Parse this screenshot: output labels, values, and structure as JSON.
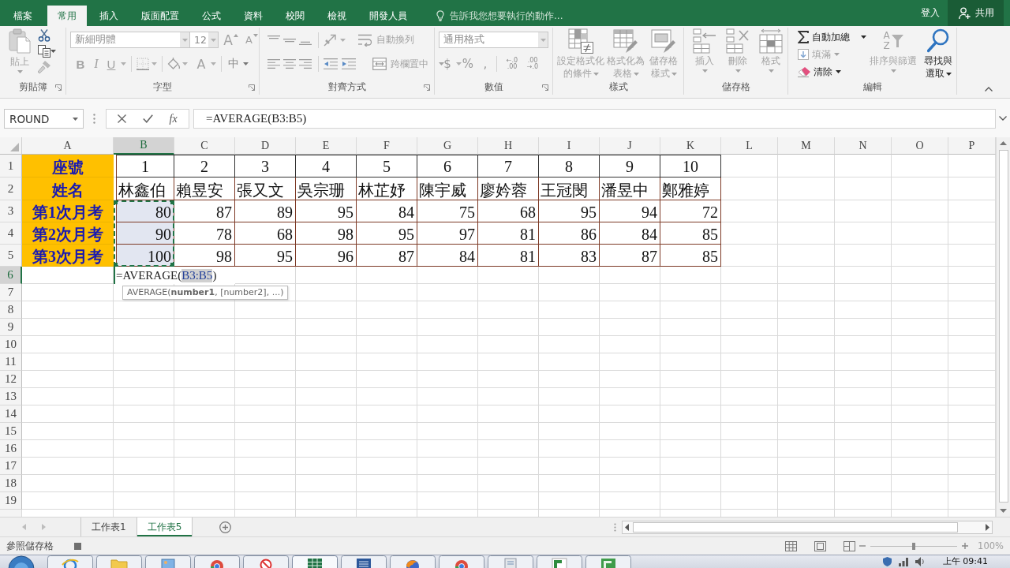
{
  "ribbon_tabs": [
    {
      "label": "檔案",
      "selected": false
    },
    {
      "label": "常用",
      "selected": true
    },
    {
      "label": "插入",
      "selected": false
    },
    {
      "label": "版面配置",
      "selected": false
    },
    {
      "label": "公式",
      "selected": false
    },
    {
      "label": "資料",
      "selected": false
    },
    {
      "label": "校閱",
      "selected": false
    },
    {
      "label": "檢視",
      "selected": false
    },
    {
      "label": "開發人員",
      "selected": false
    }
  ],
  "tell_me": {
    "placeholder": "告訴我您想要執行的動作..."
  },
  "account": {
    "sign_in": "登入",
    "share": "共用"
  },
  "ribbon": {
    "clipboard": {
      "label": "剪貼簿",
      "paste": {
        "label": "貼上",
        "disabled": true
      }
    },
    "font": {
      "label": "字型",
      "font_name": "新細明體",
      "font_size": "12",
      "glyphs": {
        "grow": "A",
        "shrink": "A",
        "bold": "B",
        "italic": "I",
        "underline": "U",
        "font_color": "A",
        "phonetic": "中"
      }
    },
    "alignment": {
      "label": "對齊方式",
      "wrap_text": {
        "label": "自動換列",
        "disabled": true
      },
      "merge_center": {
        "label": "跨欄置中",
        "disabled": true
      }
    },
    "number": {
      "label": "數值",
      "format": "通用格式",
      "glyphs": {
        "currency": "$",
        "percent": "%",
        "comma": ",",
        "increase_decimal": [
          "←.0",
          ".00"
        ],
        "decrease_decimal": [
          ".00",
          "→.0"
        ]
      }
    },
    "styles": {
      "label": "樣式",
      "buttons": [
        {
          "kind": "conditional",
          "label": "設定格式化的條件",
          "disabled": true
        },
        {
          "kind": "table",
          "label": "格式化為表格",
          "disabled": true
        },
        {
          "kind": "cellstyle",
          "label": "儲存格樣式",
          "disabled": true
        }
      ]
    },
    "cells": {
      "label": "儲存格",
      "buttons": [
        {
          "kind": "insert",
          "label": "插入",
          "disabled": true
        },
        {
          "kind": "delete",
          "label": "刪除",
          "disabled": true
        },
        {
          "kind": "format",
          "label": "格式",
          "disabled": true
        }
      ]
    },
    "editing": {
      "label": "編輯",
      "small_buttons": [
        {
          "kind": "autosum",
          "label": "自動加總",
          "disabled": false
        },
        {
          "kind": "fill",
          "label": "填滿",
          "disabled": true
        },
        {
          "kind": "clear",
          "label": "清除",
          "disabled": false
        }
      ],
      "buttons": [
        {
          "kind": "sort",
          "label": "排序與篩選",
          "glyphs": [
            "A",
            "Z"
          ],
          "disabled": true
        },
        {
          "kind": "find",
          "label": "尋找與選取",
          "disabled": false
        }
      ]
    }
  },
  "formula_bar": {
    "name_box": "ROUND",
    "function_glyph": "fx",
    "formula": "=AVERAGE(B3:B5)"
  },
  "sheet": {
    "columns": [
      {
        "label": "A",
        "selected": false
      },
      {
        "label": "B",
        "selected": true
      },
      {
        "label": "C",
        "selected": false
      },
      {
        "label": "D",
        "selected": false
      },
      {
        "label": "E",
        "selected": false
      },
      {
        "label": "F",
        "selected": false
      },
      {
        "label": "G",
        "selected": false
      },
      {
        "label": "H",
        "selected": false
      },
      {
        "label": "I",
        "selected": false
      },
      {
        "label": "J",
        "selected": false
      },
      {
        "label": "K",
        "selected": false
      },
      {
        "label": "L",
        "selected": false
      },
      {
        "label": "M",
        "selected": false
      },
      {
        "label": "N",
        "selected": false
      },
      {
        "label": "O",
        "selected": false
      },
      {
        "label": "P",
        "selected": false
      }
    ],
    "rows": [
      {
        "header": "1",
        "selected": false,
        "kind": "index",
        "label": "座號",
        "cells": [
          {
            "text": "1",
            "referenced": false
          },
          {
            "text": "2",
            "referenced": false
          },
          {
            "text": "3",
            "referenced": false
          },
          {
            "text": "4",
            "referenced": false
          },
          {
            "text": "5",
            "referenced": false
          },
          {
            "text": "6",
            "referenced": false
          },
          {
            "text": "7",
            "referenced": false
          },
          {
            "text": "8",
            "referenced": false
          },
          {
            "text": "9",
            "referenced": false
          },
          {
            "text": "10",
            "referenced": false
          }
        ]
      },
      {
        "header": "2",
        "selected": false,
        "kind": "name",
        "label": "姓名",
        "cells": [
          {
            "text": "林鑫伯",
            "referenced": false
          },
          {
            "text": "賴昱安",
            "referenced": false
          },
          {
            "text": "張又文",
            "referenced": false
          },
          {
            "text": "吳宗珊",
            "referenced": false
          },
          {
            "text": "林芷妤",
            "referenced": false
          },
          {
            "text": "陳宇威",
            "referenced": false
          },
          {
            "text": "廖妗蓉",
            "referenced": false
          },
          {
            "text": "王冠閔",
            "referenced": false
          },
          {
            "text": "潘昱中",
            "referenced": false
          },
          {
            "text": "鄭雅婷",
            "referenced": false
          }
        ]
      },
      {
        "header": "3",
        "selected": false,
        "kind": "score",
        "label": "第1次月考",
        "cells": [
          {
            "text": "80",
            "referenced": true
          },
          {
            "text": "87",
            "referenced": false
          },
          {
            "text": "89",
            "referenced": false
          },
          {
            "text": "95",
            "referenced": false
          },
          {
            "text": "84",
            "referenced": false
          },
          {
            "text": "75",
            "referenced": false
          },
          {
            "text": "68",
            "referenced": false
          },
          {
            "text": "95",
            "referenced": false
          },
          {
            "text": "94",
            "referenced": false
          },
          {
            "text": "72",
            "referenced": false
          }
        ]
      },
      {
        "header": "4",
        "selected": false,
        "kind": "score",
        "label": "第2次月考",
        "cells": [
          {
            "text": "90",
            "referenced": true
          },
          {
            "text": "78",
            "referenced": false
          },
          {
            "text": "68",
            "referenced": false
          },
          {
            "text": "98",
            "referenced": false
          },
          {
            "text": "95",
            "referenced": false
          },
          {
            "text": "97",
            "referenced": false
          },
          {
            "text": "81",
            "referenced": false
          },
          {
            "text": "86",
            "referenced": false
          },
          {
            "text": "84",
            "referenced": false
          },
          {
            "text": "85",
            "referenced": false
          }
        ]
      },
      {
        "header": "5",
        "selected": false,
        "kind": "score",
        "label": "第3次月考",
        "cells": [
          {
            "text": "100",
            "referenced": true
          },
          {
            "text": "98",
            "referenced": false
          },
          {
            "text": "95",
            "referenced": false
          },
          {
            "text": "96",
            "referenced": false
          },
          {
            "text": "87",
            "referenced": false
          },
          {
            "text": "84",
            "referenced": false
          },
          {
            "text": "81",
            "referenced": false
          },
          {
            "text": "83",
            "referenced": false
          },
          {
            "text": "87",
            "referenced": false
          },
          {
            "text": "85",
            "referenced": false
          }
        ]
      }
    ],
    "empty_rows": [
      {
        "header": "6",
        "selected": true
      },
      {
        "header": "7",
        "selected": false
      },
      {
        "header": "8",
        "selected": false
      },
      {
        "header": "9",
        "selected": false
      },
      {
        "header": "10",
        "selected": false
      },
      {
        "header": "11",
        "selected": false
      },
      {
        "header": "12",
        "selected": false
      },
      {
        "header": "13",
        "selected": false
      },
      {
        "header": "14",
        "selected": false
      },
      {
        "header": "15",
        "selected": false
      },
      {
        "header": "16",
        "selected": false
      },
      {
        "header": "17",
        "selected": false
      },
      {
        "header": "18",
        "selected": false
      },
      {
        "header": "19",
        "selected": false
      }
    ],
    "editor": {
      "parts": [
        "=AVERAGE(",
        "B3:B5",
        ")"
      ]
    },
    "tooltip": "AVERAGE(**number1**, [number2], ...)"
  },
  "sheet_tabs": [
    {
      "label": "工作表1",
      "selected": false
    },
    {
      "label": "工作表5",
      "selected": true
    }
  ],
  "status_bar": {
    "mode": "參照儲存格",
    "zoom": {
      "level": 0.5,
      "label": "100%"
    }
  },
  "taskbar": {
    "clock": "上午 09:41"
  }
}
